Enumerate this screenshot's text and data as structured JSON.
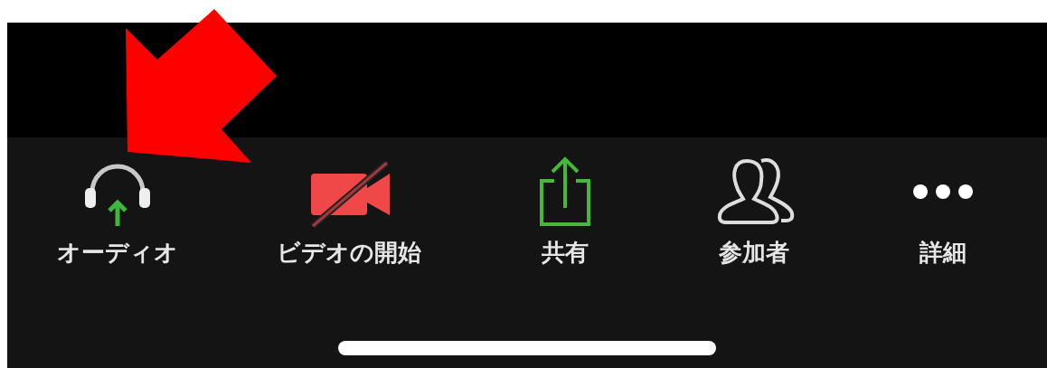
{
  "toolbar": {
    "buttons": [
      {
        "kind": "audio",
        "label": "オーディオ"
      },
      {
        "kind": "video-off",
        "label": "ビデオの開始"
      },
      {
        "kind": "share",
        "label": "共有"
      },
      {
        "kind": "participants",
        "label": "参加者"
      },
      {
        "kind": "more",
        "label": "詳細"
      }
    ]
  }
}
